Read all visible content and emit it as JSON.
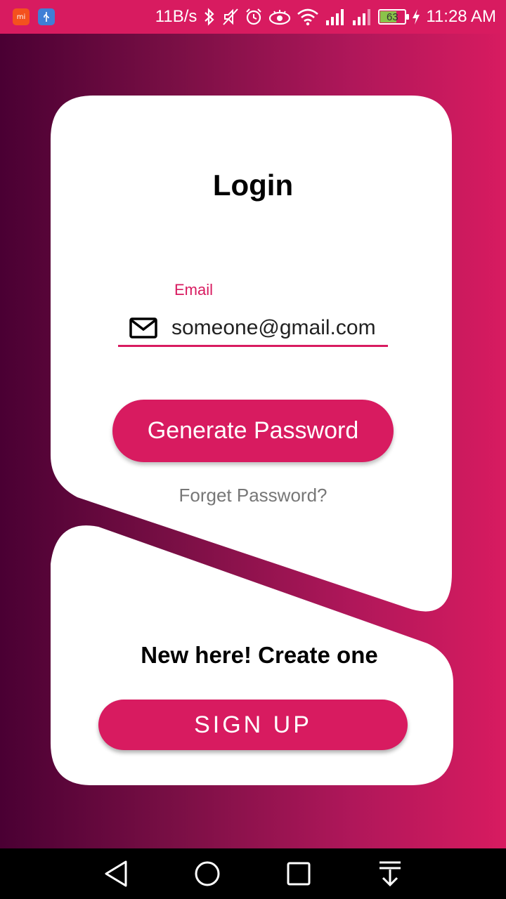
{
  "status_bar": {
    "net_speed": "11B/s",
    "battery": "63",
    "time": "11:28 AM",
    "icons": [
      "mi-icon",
      "usb-icon",
      "bluetooth-icon",
      "mute-icon",
      "alarm-icon",
      "eye-icon",
      "wifi-icon",
      "signal-icon",
      "signal-icon",
      "battery-icon",
      "charging-icon"
    ]
  },
  "login": {
    "title": "Login",
    "email_label": "Email",
    "email_value": "someone@gmail.com",
    "generate_button": "Generate Password",
    "forget_link": "Forget Password?"
  },
  "signup": {
    "prompt": "New here! Create one",
    "button": "SIGN UP"
  },
  "colors": {
    "accent": "#d81b60",
    "bg_dark": "#4a0033"
  },
  "nav_bar": {
    "icons": [
      "back-icon",
      "home-icon",
      "recents-icon",
      "notification-pull-icon"
    ]
  }
}
